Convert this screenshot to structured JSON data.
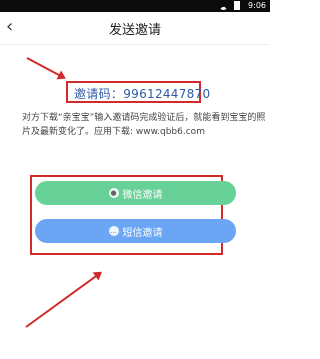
{
  "status_bar": {
    "time": "9:06"
  },
  "app_bar": {
    "title": "发送邀请",
    "back_icon": "back-chevron-icon"
  },
  "invite": {
    "code_label": "邀请码：",
    "code_value": "99612447870",
    "description": "对方下载“亲宝宝”输入邀请码完成验证后，就能看到宝宝的照片及最新变化了。应用下载: www.qbb6.com"
  },
  "buttons": {
    "wechat": {
      "label": "微信邀请",
      "icon": "wechat-icon",
      "color": "#67d198"
    },
    "sms": {
      "label": "短信邀请",
      "icon": "sms-icon",
      "color": "#6aa6f3"
    }
  },
  "annotations": {
    "color": "#d12a2a"
  }
}
